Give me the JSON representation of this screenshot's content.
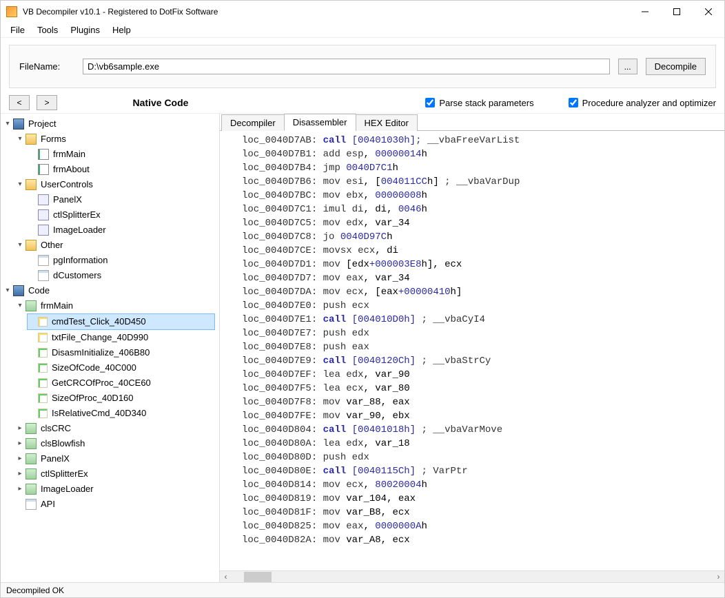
{
  "window": {
    "title": "VB Decompiler v10.1 - Registered to DotFix Software"
  },
  "menu": {
    "file": "File",
    "tools": "Tools",
    "plugins": "Plugins",
    "help": "Help"
  },
  "toolbar": {
    "file_label": "FileName:",
    "file_value": "D:\\vb6sample.exe",
    "browse": "...",
    "decompile": "Decompile"
  },
  "options": {
    "back": "<",
    "forward": ">",
    "native_label": "Native Code",
    "parse_stack": "Parse stack parameters",
    "proc_analyzer": "Procedure analyzer and optimizer"
  },
  "tree": {
    "project": "Project",
    "forms": "Forms",
    "frmMain": "frmMain",
    "frmAbout": "frmAbout",
    "userControls": "UserControls",
    "panelX": "PanelX",
    "ctlSplitterEx": "ctlSplitterEx",
    "imageLoader": "ImageLoader",
    "other": "Other",
    "pgInformation": "pgInformation",
    "dCustomers": "dCustomers",
    "code": "Code",
    "code_frmMain": "frmMain",
    "cmdTest": "cmdTest_Click_40D450",
    "txtFile": "txtFile_Change_40D990",
    "disasmInit": "DisasmInitialize_406B80",
    "sizeOfCode": "SizeOfCode_40C000",
    "getCRC": "GetCRCOfProc_40CE60",
    "sizeOfProc": "SizeOfProc_40D160",
    "isRelative": "IsRelativeCmd_40D340",
    "clsCRC": "clsCRC",
    "clsBlowfish": "clsBlowfish",
    "panelX2": "PanelX",
    "ctlSplitterEx2": "ctlSplitterEx",
    "imageLoader2": "ImageLoader",
    "api": "API"
  },
  "tabs": {
    "decompiler": "Decompiler",
    "disassembler": "Disassembler",
    "hex": "HEX Editor"
  },
  "code_lines": [
    {
      "loc": "loc_0040D7AB",
      "op": "call",
      "args": [
        {
          "t": "addr_br",
          "v": "[00401030h]"
        }
      ],
      "cmt": "; __vbaFreeVarList"
    },
    {
      "loc": "loc_0040D7B1",
      "op": "add",
      "args": [
        {
          "t": "reg",
          "v": "esp"
        },
        {
          "t": "p",
          "v": ", "
        },
        {
          "t": "num",
          "v": "00000014"
        },
        {
          "t": "p",
          "v": "h"
        }
      ]
    },
    {
      "loc": "loc_0040D7B4",
      "op": "jmp",
      "args": [
        {
          "t": "addr",
          "v": "0040D7C1"
        },
        {
          "t": "p",
          "v": "h"
        }
      ]
    },
    {
      "loc": "loc_0040D7B6",
      "op": "mov",
      "args": [
        {
          "t": "reg",
          "v": "esi"
        },
        {
          "t": "p",
          "v": ", ["
        },
        {
          "t": "addr",
          "v": "004011CC"
        },
        {
          "t": "p",
          "v": "h]"
        }
      ],
      "cmt": " ; __vbaVarDup"
    },
    {
      "loc": "loc_0040D7BC",
      "op": "mov",
      "args": [
        {
          "t": "reg",
          "v": "ebx"
        },
        {
          "t": "p",
          "v": ", "
        },
        {
          "t": "num",
          "v": "00000008"
        },
        {
          "t": "p",
          "v": "h"
        }
      ]
    },
    {
      "loc": "loc_0040D7C1",
      "op": "imul",
      "args": [
        {
          "t": "reg",
          "v": "di"
        },
        {
          "t": "p",
          "v": ", di, "
        },
        {
          "t": "num",
          "v": "0046"
        },
        {
          "t": "p",
          "v": "h"
        }
      ]
    },
    {
      "loc": "loc_0040D7C5",
      "op": "mov",
      "args": [
        {
          "t": "reg",
          "v": "edx"
        },
        {
          "t": "p",
          "v": ", var_34"
        }
      ]
    },
    {
      "loc": "loc_0040D7C8",
      "op": "jo",
      "args": [
        {
          "t": "addr",
          "v": "0040D97C"
        },
        {
          "t": "p",
          "v": "h"
        }
      ]
    },
    {
      "loc": "loc_0040D7CE",
      "op": "movsx",
      "args": [
        {
          "t": "reg",
          "v": "ecx"
        },
        {
          "t": "p",
          "v": ", di"
        }
      ]
    },
    {
      "loc": "loc_0040D7D1",
      "op": "mov",
      "args": [
        {
          "t": "p",
          "v": "[edx"
        },
        {
          "t": "addr",
          "v": "+000003E8"
        },
        {
          "t": "p",
          "v": "h], ecx"
        }
      ]
    },
    {
      "loc": "loc_0040D7D7",
      "op": "mov",
      "args": [
        {
          "t": "reg",
          "v": "eax"
        },
        {
          "t": "p",
          "v": ", var_34"
        }
      ]
    },
    {
      "loc": "loc_0040D7DA",
      "op": "mov",
      "args": [
        {
          "t": "reg",
          "v": "ecx"
        },
        {
          "t": "p",
          "v": ", [eax"
        },
        {
          "t": "addr",
          "v": "+00000410"
        },
        {
          "t": "p",
          "v": "h]"
        }
      ]
    },
    {
      "loc": "loc_0040D7E0",
      "op": "push",
      "args": [
        {
          "t": "reg",
          "v": "ecx"
        }
      ]
    },
    {
      "loc": "loc_0040D7E1",
      "op": "call",
      "args": [
        {
          "t": "addr_br",
          "v": "[004010D0h]"
        }
      ],
      "cmt": " ; __vbaCyI4"
    },
    {
      "loc": "loc_0040D7E7",
      "op": "push",
      "args": [
        {
          "t": "reg",
          "v": "edx"
        }
      ]
    },
    {
      "loc": "loc_0040D7E8",
      "op": "push",
      "args": [
        {
          "t": "reg",
          "v": "eax"
        }
      ]
    },
    {
      "loc": "loc_0040D7E9",
      "op": "call",
      "args": [
        {
          "t": "addr_br",
          "v": "[0040120Ch]"
        }
      ],
      "cmt": " ; __vbaStrCy"
    },
    {
      "loc": "loc_0040D7EF",
      "op": "lea",
      "args": [
        {
          "t": "reg",
          "v": "edx"
        },
        {
          "t": "p",
          "v": ", var_90"
        }
      ]
    },
    {
      "loc": "loc_0040D7F5",
      "op": "lea",
      "args": [
        {
          "t": "reg",
          "v": "ecx"
        },
        {
          "t": "p",
          "v": ", var_80"
        }
      ]
    },
    {
      "loc": "loc_0040D7F8",
      "op": "mov",
      "args": [
        {
          "t": "p",
          "v": "var_88, eax"
        }
      ]
    },
    {
      "loc": "loc_0040D7FE",
      "op": "mov",
      "args": [
        {
          "t": "p",
          "v": "var_90, ebx"
        }
      ]
    },
    {
      "loc": "loc_0040D804",
      "op": "call",
      "args": [
        {
          "t": "addr_br",
          "v": "[00401018h]"
        }
      ],
      "cmt": " ; __vbaVarMove"
    },
    {
      "loc": "loc_0040D80A",
      "op": "lea",
      "args": [
        {
          "t": "reg",
          "v": "edx"
        },
        {
          "t": "p",
          "v": ", var_18"
        }
      ]
    },
    {
      "loc": "loc_0040D80D",
      "op": "push",
      "args": [
        {
          "t": "reg",
          "v": "edx"
        }
      ]
    },
    {
      "loc": "loc_0040D80E",
      "op": "call",
      "args": [
        {
          "t": "addr_br",
          "v": "[0040115Ch]"
        }
      ],
      "cmt": " ; VarPtr"
    },
    {
      "loc": "loc_0040D814",
      "op": "mov",
      "args": [
        {
          "t": "reg",
          "v": "ecx"
        },
        {
          "t": "p",
          "v": ", "
        },
        {
          "t": "num",
          "v": "80020004"
        },
        {
          "t": "p",
          "v": "h"
        }
      ]
    },
    {
      "loc": "loc_0040D819",
      "op": "mov",
      "args": [
        {
          "t": "p",
          "v": "var_104, eax"
        }
      ]
    },
    {
      "loc": "loc_0040D81F",
      "op": "mov",
      "args": [
        {
          "t": "p",
          "v": "var_B8, ecx"
        }
      ]
    },
    {
      "loc": "loc_0040D825",
      "op": "mov",
      "args": [
        {
          "t": "reg",
          "v": "eax"
        },
        {
          "t": "p",
          "v": ", "
        },
        {
          "t": "num",
          "v": "0000000A"
        },
        {
          "t": "p",
          "v": "h"
        }
      ]
    },
    {
      "loc": "loc_0040D82A",
      "op": "mov",
      "args": [
        {
          "t": "p",
          "v": "var_A8, ecx"
        }
      ]
    }
  ],
  "status": "Decompiled OK"
}
